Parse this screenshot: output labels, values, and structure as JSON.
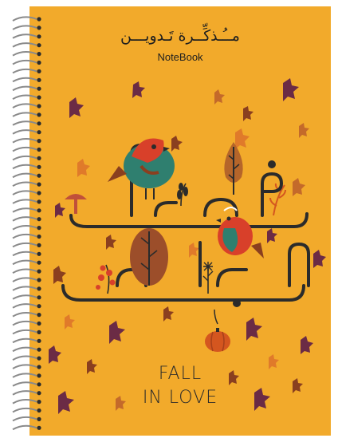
{
  "cover": {
    "title_arabic": "مــُـذكِّــرة تَـدويـــن",
    "title_english": "NoteBook",
    "art_arabic": "فصل الخريف",
    "slogan_line1": "FALL",
    "slogan_line2": "IN LOVE"
  },
  "colors": {
    "background": "#f2aa2b",
    "ink": "#2b2b2b",
    "leaf_brown": "#8a3f1f",
    "leaf_purple": "#6b2b45",
    "bird_teal": "#2f7f6f",
    "bird_red": "#d8402a",
    "pumpkin": "#d4561f"
  },
  "icons": [
    "spiral-binding-icon",
    "bird-icon",
    "tree-icon",
    "mushroom-icon",
    "leaf-icon",
    "pumpkin-icon",
    "berry-branch-icon"
  ]
}
